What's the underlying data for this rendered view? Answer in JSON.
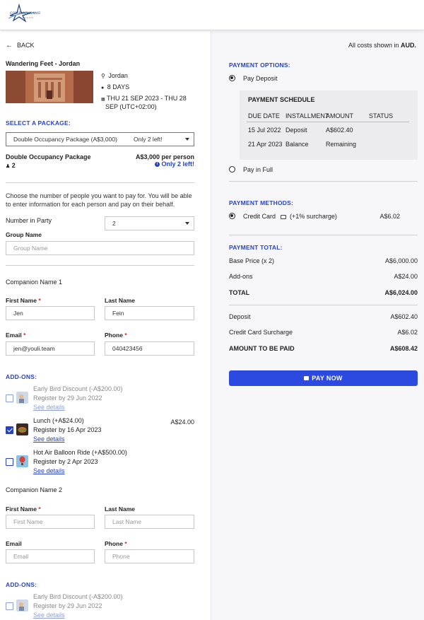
{
  "brand": {
    "logo_text": "COMPANY NAME",
    "logo_sub": "SLOGAN"
  },
  "nav": {
    "back_label": "BACK"
  },
  "costs_note": {
    "prefix": "All costs shown in ",
    "currency": "AUD."
  },
  "trip": {
    "title": "Wandering Feet - Jordan",
    "location": "Jordan",
    "duration": "8 DAYS",
    "dates_line1": "THU 21 SEP 2023 - THU 28",
    "dates_line2": "SEP (UTC+02:00)"
  },
  "package": {
    "section_label": "SELECT A PACKAGE:",
    "select_value": "Double Occupancy Package (A$3,000)",
    "select_badge": "Only 2 left!",
    "name": "Double Occupancy Package",
    "count": "2",
    "price": "A$3,000 per person",
    "availability": "Only 2 left!"
  },
  "party": {
    "intro": "Choose the number of people you want to pay for. You will be able to enter information for each person and pay on their behalf.",
    "number_label": "Number in Party",
    "number_value": "2",
    "group_label": "Group Name",
    "group_placeholder": "Group Name"
  },
  "companions": [
    {
      "title": "Companion Name 1",
      "first_label": "First Name",
      "last_label": "Last Name",
      "email_label": "Email",
      "phone_label": "Phone",
      "first_value": "Jen",
      "last_value": "Fein",
      "email_value": "jen@youli.team",
      "phone_value": "040423456"
    },
    {
      "title": "Companion Name 2",
      "first_label": "First Name",
      "last_label": "Last Name",
      "email_label": "Email",
      "phone_label": "Phone",
      "first_placeholder": "First Name",
      "last_placeholder": "Last Name",
      "email_placeholder": "Email",
      "phone_placeholder": "Phone"
    }
  ],
  "addons_label": "ADD-ONS:",
  "addons1": [
    {
      "name": "Early Bird Discount (-A$200.00)",
      "sub": "Register by 29 Jun 2022",
      "link": "See details",
      "checked": false,
      "price": ""
    },
    {
      "name": "Lunch (+A$24.00)",
      "sub": "Register by 16 Apr 2023",
      "link": "See details",
      "checked": true,
      "price": "A$24.00"
    },
    {
      "name": "Hot Air Balloon Ride (+A$500.00)",
      "sub": "Register by 2 Apr 2023",
      "link": "See details",
      "checked": false,
      "price": ""
    }
  ],
  "addons2": [
    {
      "name": "Early Bird Discount (-A$200.00)",
      "sub": "Register by 29 Jun 2022",
      "link": "See details",
      "checked": false
    }
  ],
  "payment_options": {
    "label": "PAYMENT OPTIONS:",
    "deposit_label": "Pay Deposit",
    "full_label": "Pay in Full",
    "schedule": {
      "title": "PAYMENT SCHEDULE",
      "headers": [
        "DUE DATE",
        "INSTALLMENT",
        "AMOUNT",
        "STATUS"
      ],
      "rows": [
        {
          "date": "15 Jul 2022",
          "inst": "Deposit",
          "amount": "A$602.40",
          "status": ""
        },
        {
          "date": "21 Apr 2023",
          "inst": "Balance",
          "amount": "Remaining",
          "status": ""
        }
      ]
    }
  },
  "payment_methods": {
    "label": "PAYMENT METHODS:",
    "method_label": "Credit Card",
    "surcharge": "(+1% surcharge)",
    "amount": "A$6.02"
  },
  "totals": {
    "label": "PAYMENT TOTAL:",
    "base_label": "Base Price (x 2)",
    "base_value": "A$6,000.00",
    "addons_label": "Add-ons",
    "addons_value": "A$24.00",
    "total_label": "TOTAL",
    "total_value": "A$6,024.00",
    "deposit_label": "Deposit",
    "deposit_value": "A$602.40",
    "surcharge_label": "Credit Card Surcharge",
    "surcharge_value": "A$6.02",
    "due_label": "AMOUNT TO BE PAID",
    "due_value": "A$608.42"
  },
  "pay_button": "PAY NOW",
  "colors": {
    "accent": "#2743c4",
    "button": "#2d4ae0"
  }
}
